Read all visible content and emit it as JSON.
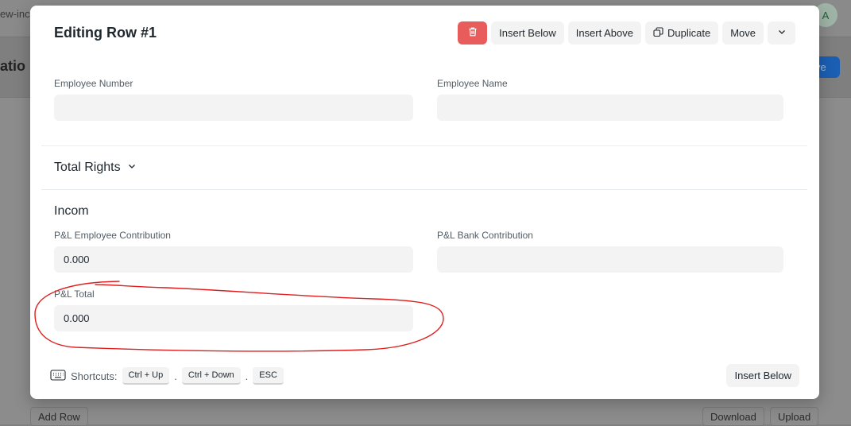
{
  "background": {
    "breadcrumb": "ew-inc",
    "avatar_initial": "A",
    "page_title": "atio",
    "save_label": "ve",
    "add_row": "Add Row",
    "download": "Download",
    "upload": "Upload"
  },
  "modal": {
    "title": "Editing Row #1",
    "toolbar": {
      "delete_icon": "trash-icon",
      "insert_below": "Insert Below",
      "insert_above": "Insert Above",
      "duplicate": "Duplicate",
      "move": "Move",
      "more_icon": "chevron-down-icon"
    },
    "fields": {
      "employee_number": {
        "label": "Employee Number",
        "value": ""
      },
      "employee_name": {
        "label": "Employee Name",
        "value": ""
      },
      "pl_employee_contribution": {
        "label": "P&L Employee Contribution",
        "value": "0.000"
      },
      "pl_bank_contribution": {
        "label": "P&L Bank Contribution",
        "value": ""
      },
      "pl_total": {
        "label": "P&L Total",
        "value": "0.000"
      }
    },
    "sections": {
      "total_rights": "Total Rights",
      "incom": "Incom"
    },
    "shortcuts": {
      "label": "Shortcuts:",
      "keys": [
        "Ctrl + Up",
        "Ctrl + Down",
        "ESC"
      ],
      "separator": "."
    },
    "footer_insert_below": "Insert Below"
  },
  "colors": {
    "danger": "#e85c5c",
    "field_bg": "#f3f3f3",
    "annotation": "#e01e1e"
  }
}
